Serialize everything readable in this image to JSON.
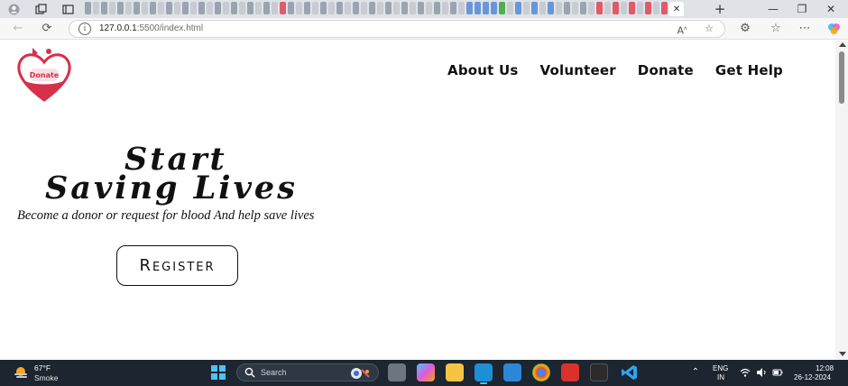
{
  "browser": {
    "url_host": "127.0.0.1",
    "url_path": ":5500/index.html"
  },
  "site": {
    "logo_text": "Donate",
    "nav": [
      "About Us",
      "Volunteer",
      "Donate",
      "Get Help"
    ],
    "hero": {
      "title_line1": "Start",
      "title_line2": "Saving Lives",
      "subtitle": "Become a donor or request for blood And help save lives",
      "cta_label": "Register"
    },
    "colors": {
      "brand_red": "#d6304a",
      "text": "#111111"
    }
  },
  "taskbar": {
    "weather_temp": "67°F",
    "weather_condition": "Smoke",
    "search_placeholder": "Search",
    "lang_line1": "ENG",
    "lang_line2": "IN",
    "time": "12:08",
    "date": "26-12-2024"
  }
}
